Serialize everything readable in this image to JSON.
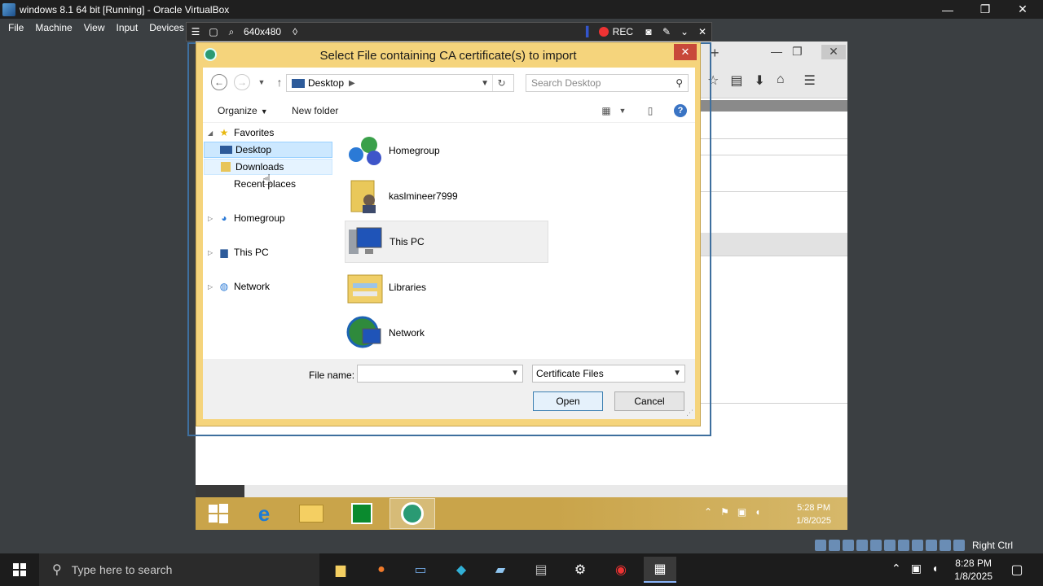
{
  "host": {
    "window_title": "windows 8.1 64 bit [Running] - Oracle VirtualBox",
    "menu": [
      "File",
      "Machine",
      "View",
      "Input",
      "Devices"
    ],
    "mini_toolbar": {
      "resolution": "640x480",
      "rec_label": "REC"
    },
    "status_bar": {
      "host_key": "Right Ctrl"
    },
    "taskbar": {
      "search_placeholder": "Type here to search",
      "time": "8:28 PM",
      "date": "1/8/2025"
    }
  },
  "guest": {
    "taskbar": {
      "time": "5:28 PM",
      "date": "1/8/2025"
    }
  },
  "dialog": {
    "title": "Select File containing CA certificate(s) to import",
    "address": {
      "location": "Desktop"
    },
    "search_placeholder": "Search Desktop",
    "commands": {
      "organize": "Organize",
      "new_folder": "New folder"
    },
    "nav_pane": {
      "favorites": "Favorites",
      "desktop": "Desktop",
      "downloads": "Downloads",
      "recent_places": "Recent places",
      "homegroup": "Homegroup",
      "this_pc": "This PC",
      "network": "Network"
    },
    "files": [
      {
        "name": "Homegroup",
        "icon": "homegroup-icon"
      },
      {
        "name": "kaslmineer7999",
        "icon": "user-folder-icon"
      },
      {
        "name": "This PC",
        "icon": "computer-icon"
      },
      {
        "name": "Libraries",
        "icon": "libraries-icon"
      },
      {
        "name": "Network",
        "icon": "network-icon"
      }
    ],
    "file_name_label": "File name:",
    "file_name_value": "",
    "file_type_value": "Certificate Files",
    "open_label": "Open",
    "cancel_label": "Cancel"
  },
  "colors": {
    "dialog_frame": "#f5d47c",
    "close_button": "#c8483a",
    "selection": "#cce8ff",
    "guest_taskbar": "#c9a44a"
  }
}
